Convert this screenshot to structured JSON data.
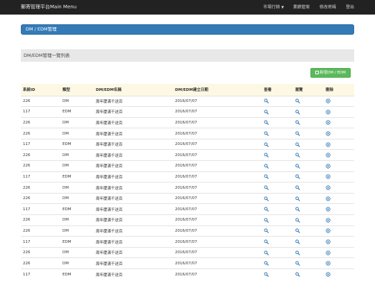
{
  "navbar": {
    "brand": "郵寄管理平台Main Menu",
    "items": [
      {
        "label": "市場行銷",
        "dropdown": true
      },
      {
        "label": "業績管案"
      },
      {
        "label": "修改密碼"
      },
      {
        "label": "登出"
      }
    ]
  },
  "panel": {
    "title": "DM / EDM管理"
  },
  "section": {
    "title": "DM/EDM管理一覽列表"
  },
  "add_button": {
    "label": "新增DM / EDM",
    "icon": "add-icon"
  },
  "table": {
    "headers": [
      "系統ID",
      "類型",
      "DM/EDM名稱",
      "DM/EDM建立日期",
      "查看",
      "瀏覽",
      "刪除"
    ],
    "rows": [
      {
        "id": "226",
        "type": "DM",
        "name": "周年慶滿千送百",
        "date": "2016/07/07"
      },
      {
        "id": "117",
        "type": "EDM",
        "name": "周年慶滿千送百",
        "date": "2016/07/07"
      },
      {
        "id": "226",
        "type": "DM",
        "name": "周年慶滿千送百",
        "date": "2016/07/07"
      },
      {
        "id": "226",
        "type": "DM",
        "name": "周年慶滿千送百",
        "date": "2016/07/07"
      },
      {
        "id": "117",
        "type": "EDM",
        "name": "周年慶滿千送百",
        "date": "2016/07/07"
      },
      {
        "id": "226",
        "type": "DM",
        "name": "周年慶滿千送百",
        "date": "2016/07/07"
      },
      {
        "id": "226",
        "type": "DM",
        "name": "周年慶滿千送百",
        "date": "2016/07/07"
      },
      {
        "id": "117",
        "type": "EDM",
        "name": "周年慶滿千送百",
        "date": "2016/07/07"
      },
      {
        "id": "226",
        "type": "DM",
        "name": "周年慶滿千送百",
        "date": "2016/07/07"
      },
      {
        "id": "226",
        "type": "DM",
        "name": "周年慶滿千送百",
        "date": "2016/07/07"
      },
      {
        "id": "117",
        "type": "EDM",
        "name": "周年慶滿千送百",
        "date": "2016/07/07"
      },
      {
        "id": "226",
        "type": "DM",
        "name": "周年慶滿千送百",
        "date": "2016/07/07"
      },
      {
        "id": "226",
        "type": "DM",
        "name": "周年慶滿千送百",
        "date": "2016/07/07"
      },
      {
        "id": "117",
        "type": "EDM",
        "name": "周年慶滿千送百",
        "date": "2016/07/07"
      },
      {
        "id": "226",
        "type": "DM",
        "name": "周年慶滿千送百",
        "date": "2016/07/07"
      },
      {
        "id": "226",
        "type": "DM",
        "name": "周年慶滿千送百",
        "date": "2016/07/07"
      },
      {
        "id": "117",
        "type": "EDM",
        "name": "周年慶滿千送百",
        "date": "2016/07/07"
      }
    ],
    "row_icons": {
      "view": "search-icon",
      "preview": "search-icon",
      "delete": "remove-circle-icon"
    }
  },
  "colors": {
    "navbar_bg": "#222222",
    "panel_blue": "#337ab7",
    "success_green": "#5cb85c",
    "header_row_bg": "#fcf8e3",
    "icon_blue": "#337ab7"
  }
}
